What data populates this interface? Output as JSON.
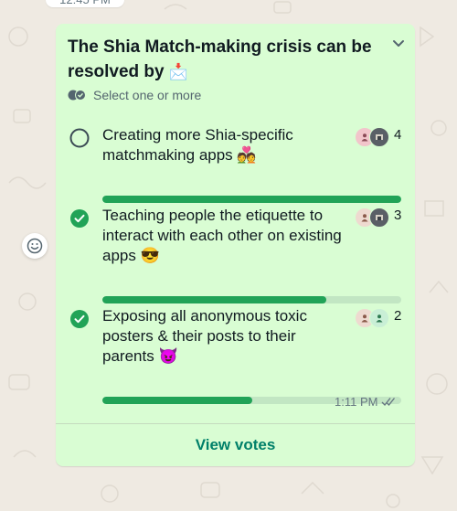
{
  "status_time": "12:45 PM",
  "poll": {
    "question": "The Shia Match-making crisis can be resolved by",
    "question_emoji": "📩",
    "select_hint": "Select one or more",
    "options": [
      {
        "text": "Creating more Shia-specific matchmaking apps",
        "emoji": "💑",
        "votes": "4",
        "selected": false,
        "share": 1.0
      },
      {
        "text": "Teaching people the etiquette to interact with each other on existing apps",
        "emoji": "😎",
        "votes": "3",
        "selected": true,
        "share": 0.75
      },
      {
        "text": "Exposing all anonymous toxic posters & their posts to their parents",
        "emoji": "😈",
        "votes": "2",
        "selected": true,
        "share": 0.5
      }
    ],
    "sent_time": "1:11 PM",
    "view_votes_label": "View votes"
  },
  "colors": {
    "bubble": "#d9fdd3",
    "bar_fill": "#21a357",
    "bar_track": "#c2e6c3",
    "link": "#008069",
    "wallpaper": "#efeae2"
  },
  "icons": {
    "chevron": "chevron-down-icon",
    "multi_select": "double-check-circle-icon",
    "react": "emoji-smile-icon",
    "read_receipt": "double-tick-icon"
  }
}
